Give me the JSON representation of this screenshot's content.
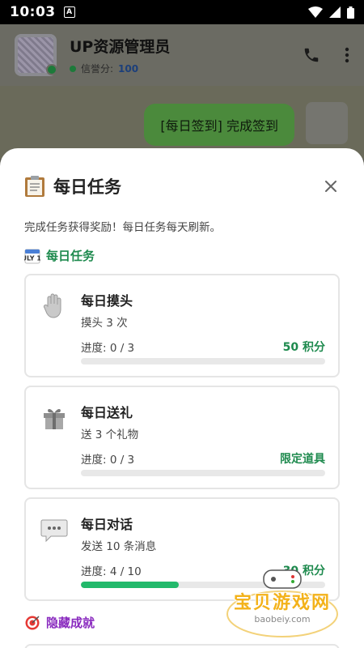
{
  "status_bar": {
    "time": "10:03",
    "a_label": "A"
  },
  "chat": {
    "name": "UP资源管理员",
    "credit_label": "信誉分:",
    "credit_value": "100",
    "sent_message": "[每日签到] 完成签到"
  },
  "sheet": {
    "title": "每日任务",
    "description": "完成任务获得奖励！每日任务每天刷新。",
    "section_daily": "每日任务",
    "section_hidden": "隐藏成就",
    "calendar_icon_label": "JULY 17",
    "tasks": [
      {
        "name": "每日摸头",
        "desc": "摸头 3 次",
        "progress_text": "进度: 0 / 3",
        "reward": "50 积分",
        "progress": 0.0,
        "icon": "hand-icon"
      },
      {
        "name": "每日送礼",
        "desc": "送 3 个礼物",
        "progress_text": "进度: 0 / 3",
        "reward": "限定道具",
        "progress": 0.0,
        "icon": "gift-icon"
      },
      {
        "name": "每日对话",
        "desc": "发送 10 条消息",
        "progress_text": "进度: 4 / 10",
        "reward": "30 积分",
        "progress": 0.4,
        "icon": "speech-bubble-icon"
      }
    ]
  },
  "watermark": {
    "title": "宝贝游戏网",
    "url": "baobeiy.com"
  },
  "colors": {
    "accent_green": "#1e8a4e",
    "progress_green": "#22b96b",
    "purple": "#8a2bbf",
    "dim_overlay": "#6b6b63"
  }
}
